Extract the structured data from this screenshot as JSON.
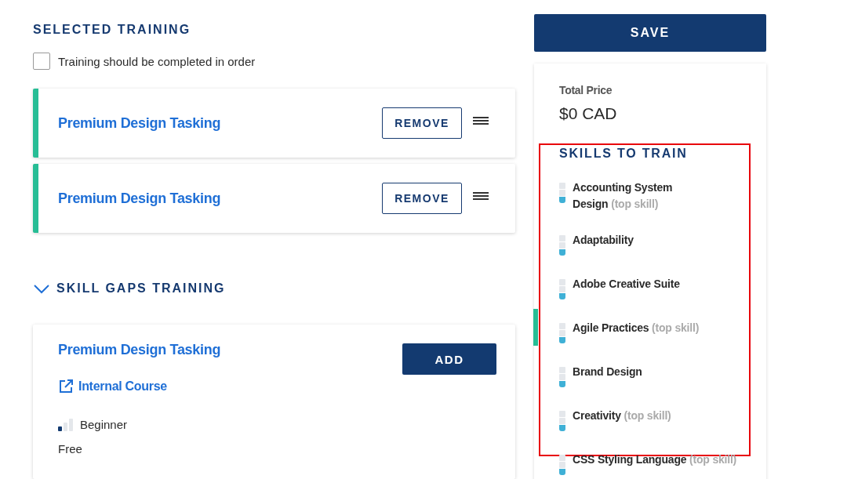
{
  "selected_training": {
    "title": "SELECTED TRAINING",
    "in_order": {
      "label": "Training should be completed in order",
      "checked": false
    },
    "items": [
      {
        "title": "Premium Design Tasking",
        "button": "REMOVE"
      },
      {
        "title": "Premium Design Tasking",
        "button": "REMOVE"
      }
    ]
  },
  "skill_gaps": {
    "title": "SKILL GAPS TRAINING",
    "expanded": true,
    "courses": [
      {
        "title": "Premium Design Tasking",
        "button": "ADD",
        "link": "Internal Course",
        "level_label": "Beginner",
        "level": 0.33,
        "price": "Free"
      }
    ]
  },
  "sidebar": {
    "save": "SAVE",
    "price_label": "Total Price",
    "price": "$0 CAD",
    "skills_title": "SKILLS TO TRAIN",
    "skills": [
      {
        "name": "Accounting System Design",
        "note": "(top skill)",
        "level": 0.33
      },
      {
        "name": "Adaptability",
        "level": 0.33
      },
      {
        "name": "Adobe Creative Suite",
        "level": 0.33
      },
      {
        "name": "Agile Practices",
        "note": "(top skill)",
        "level": 0.33
      },
      {
        "name": "Brand Design",
        "level": 0.33
      },
      {
        "name": "Creativity",
        "note": "(top skill)",
        "level": 0.33
      },
      {
        "name": "CSS Styling Language",
        "note": "(top skill)",
        "level": 0.33
      }
    ]
  }
}
